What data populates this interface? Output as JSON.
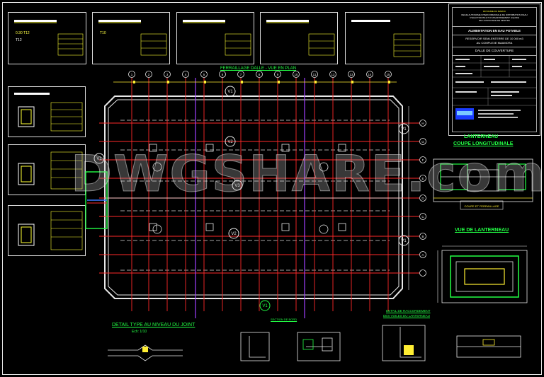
{
  "title_block": {
    "line1": "ROYAUME DU MAROC",
    "line2": "REGIE AUTONOME INTERCOMMUNALE DE DISTRIBUTION D'EAU",
    "line3": "D'ELECTRICITE ET D'ASSAINISSEMENT LIQUIDE",
    "line4": "DE LA PROVINCE DE KENITRA",
    "project": "ALIMENTATION EN EAU POTABLE",
    "subject_1": "RESERVOIR SEMI-ENTERRE DE 10 000 m3",
    "subject_2": "AU COMPLEXE MAAMORA",
    "sheet_title": "DALLE DE COUVERTURE"
  },
  "plan": {
    "title": "FERRAILLAGE DALLE - VUE EN PLAN",
    "col_labels": [
      "1",
      "2",
      "3",
      "4",
      "5",
      "6",
      "7",
      "8",
      "9",
      "10",
      "11",
      "12",
      "13",
      "14",
      "15",
      "16",
      "17"
    ],
    "row_labels": [
      "H",
      "G",
      "F",
      "E",
      "D",
      "C",
      "B",
      "A"
    ],
    "section_marks": [
      "V1",
      "V1",
      "V1",
      "V2",
      "V3",
      "V2",
      "V1",
      "V1",
      "V1"
    ]
  },
  "lanterneau": {
    "title_1": "LANTERNEAU",
    "title_2": "COUPE LONGITUDINALE",
    "view_title": "VUE DE LANTERNEAU"
  },
  "details": {
    "joint_title": "DETAIL TYPE AU NIVEAU DU JOINT",
    "joint_scale": "Ech: 1/10",
    "section_title": "SECTION DE BORD",
    "anchor_title": "DETAIL DE RACCORDEMENT",
    "anchor_sub": "DES VOILES DU LANTERNEAU"
  },
  "watermark": "DWGSHARE.com",
  "colors": {
    "background": "#000000",
    "structure": "#e8e8e8",
    "red_axis": "#ff2a2a",
    "magenta_axis": "#a040ff",
    "green_text": "#22ff44",
    "yellow_text": "#ffee33",
    "cyan_text": "#33ffff"
  }
}
